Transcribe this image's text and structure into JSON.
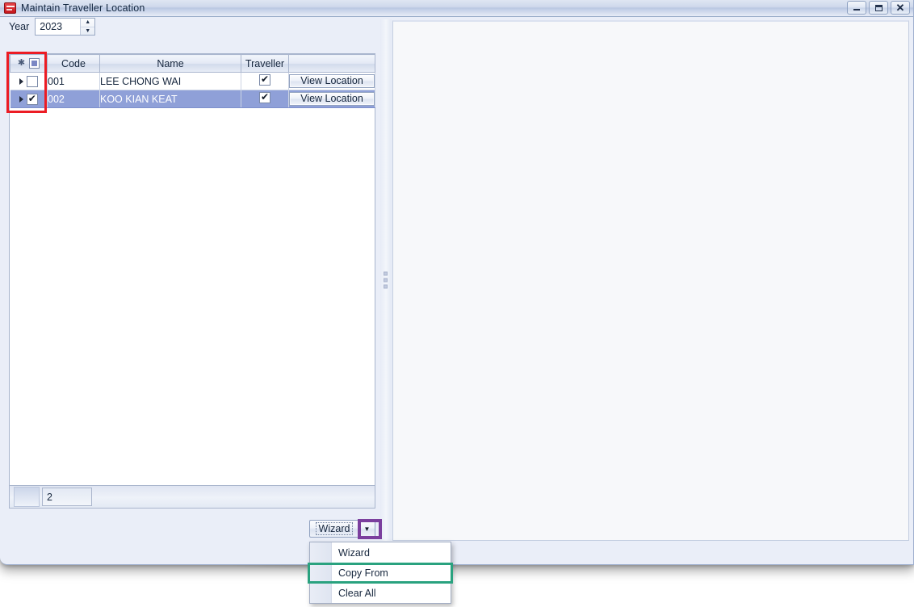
{
  "window": {
    "title": "Maintain Traveller Location",
    "icon": "app-icon",
    "controls": {
      "minimize": "minimize-button",
      "maximize": "maximize-button",
      "close": "close-button"
    }
  },
  "toolbar": {
    "year_label": "Year",
    "year_value": "2023",
    "spin_up": "▲",
    "spin_down": "▼"
  },
  "grid": {
    "columns": [
      "",
      "Code",
      "Name",
      "Traveller",
      ""
    ],
    "header_select_all": "indeterminate",
    "rows": [
      {
        "current": true,
        "selected_checkbox": false,
        "code": "001",
        "name": "LEE CHONG WAI",
        "traveller": true,
        "action_label": "View Location",
        "row_highlighted": false
      },
      {
        "current": true,
        "selected_checkbox": true,
        "code": "002",
        "name": "KOO KIAN KEAT",
        "traveller": true,
        "action_label": "View Location",
        "row_highlighted": true
      }
    ]
  },
  "statusbar": {
    "record_count": "2"
  },
  "wizard_button": {
    "label": "Wizard",
    "arrow": "▼"
  },
  "menu": {
    "items": [
      {
        "label": "Wizard"
      },
      {
        "label": "Copy From"
      },
      {
        "label": "Clear All"
      }
    ]
  },
  "annotations": {
    "red_box": "row-selector-column",
    "purple_box": "wizard-dropdown-arrow",
    "green_box": "copy-from-menu-item"
  },
  "colors": {
    "annotation_red": "#ec1c24",
    "annotation_purple": "#7b3f9e",
    "annotation_green": "#2aa27f",
    "row_selected": "#8fa0d8",
    "window_body": "#eaeef8"
  }
}
